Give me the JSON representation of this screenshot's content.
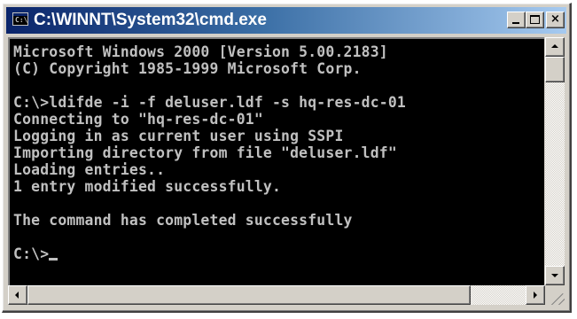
{
  "window": {
    "title": "C:\\WINNT\\System32\\cmd.exe",
    "icon": "console-app-icon",
    "icon_glyph": "C:\\"
  },
  "title_buttons": {
    "minimize": "minimize-icon",
    "maximize": "maximize-icon",
    "close": "close-icon",
    "close_glyph": "×"
  },
  "console": {
    "lines": [
      "Microsoft Windows 2000 [Version 5.00.2183]",
      "(C) Copyright 1985-1999 Microsoft Corp.",
      "",
      "C:\\>ldifde -i -f deluser.ldf -s hq-res-dc-01",
      "Connecting to \"hq-res-dc-01\"",
      "Logging in as current user using SSPI",
      "Importing directory from file \"deluser.ldf\"",
      "Loading entries..",
      "1 entry modified successfully.",
      "",
      "The command has completed successfully",
      ""
    ],
    "prompt": "C:\\>"
  },
  "colors": {
    "titlebar_start": "#0a246a",
    "titlebar_end": "#a6caf0",
    "console_bg": "#000000",
    "console_text": "#c0c0c0",
    "chrome": "#d4d0c8"
  }
}
